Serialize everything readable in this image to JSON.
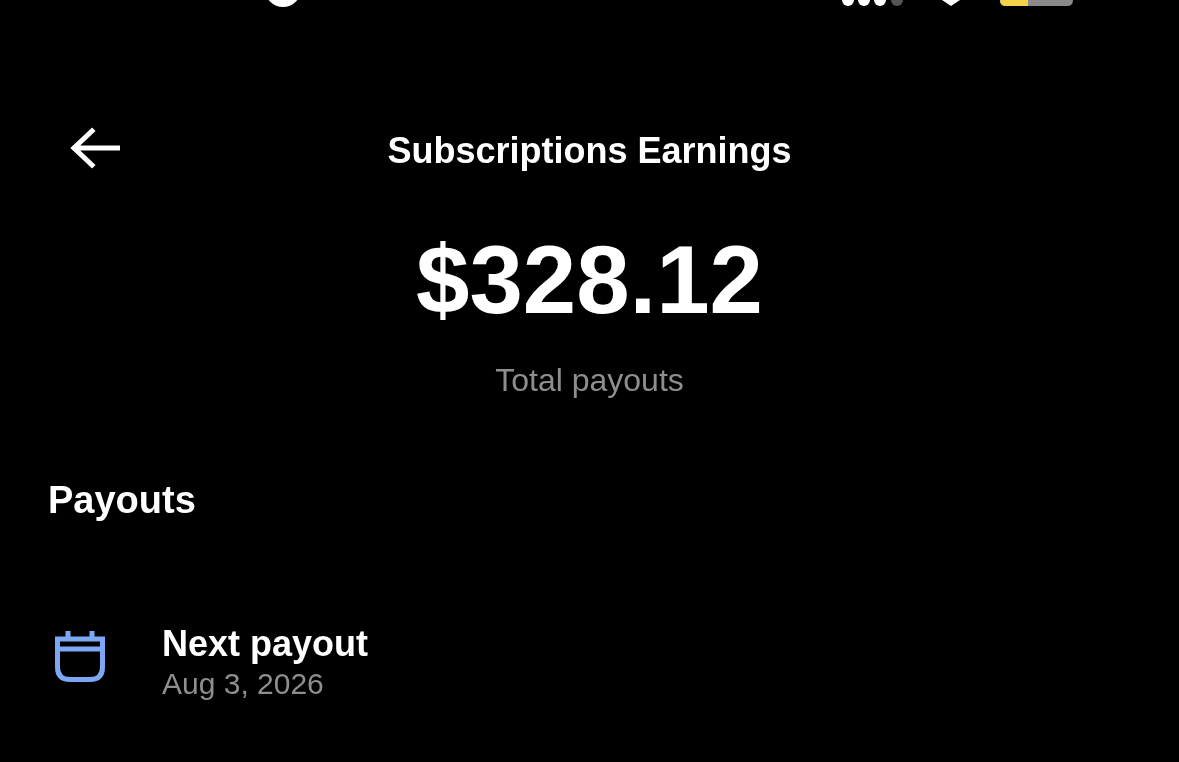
{
  "header": {
    "title": "Subscriptions Earnings"
  },
  "summary": {
    "amount": "$328.12",
    "caption": "Total payouts"
  },
  "payouts": {
    "heading": "Payouts",
    "items": [
      {
        "title": "Next payout",
        "date": "Aug 3, 2026"
      }
    ]
  }
}
